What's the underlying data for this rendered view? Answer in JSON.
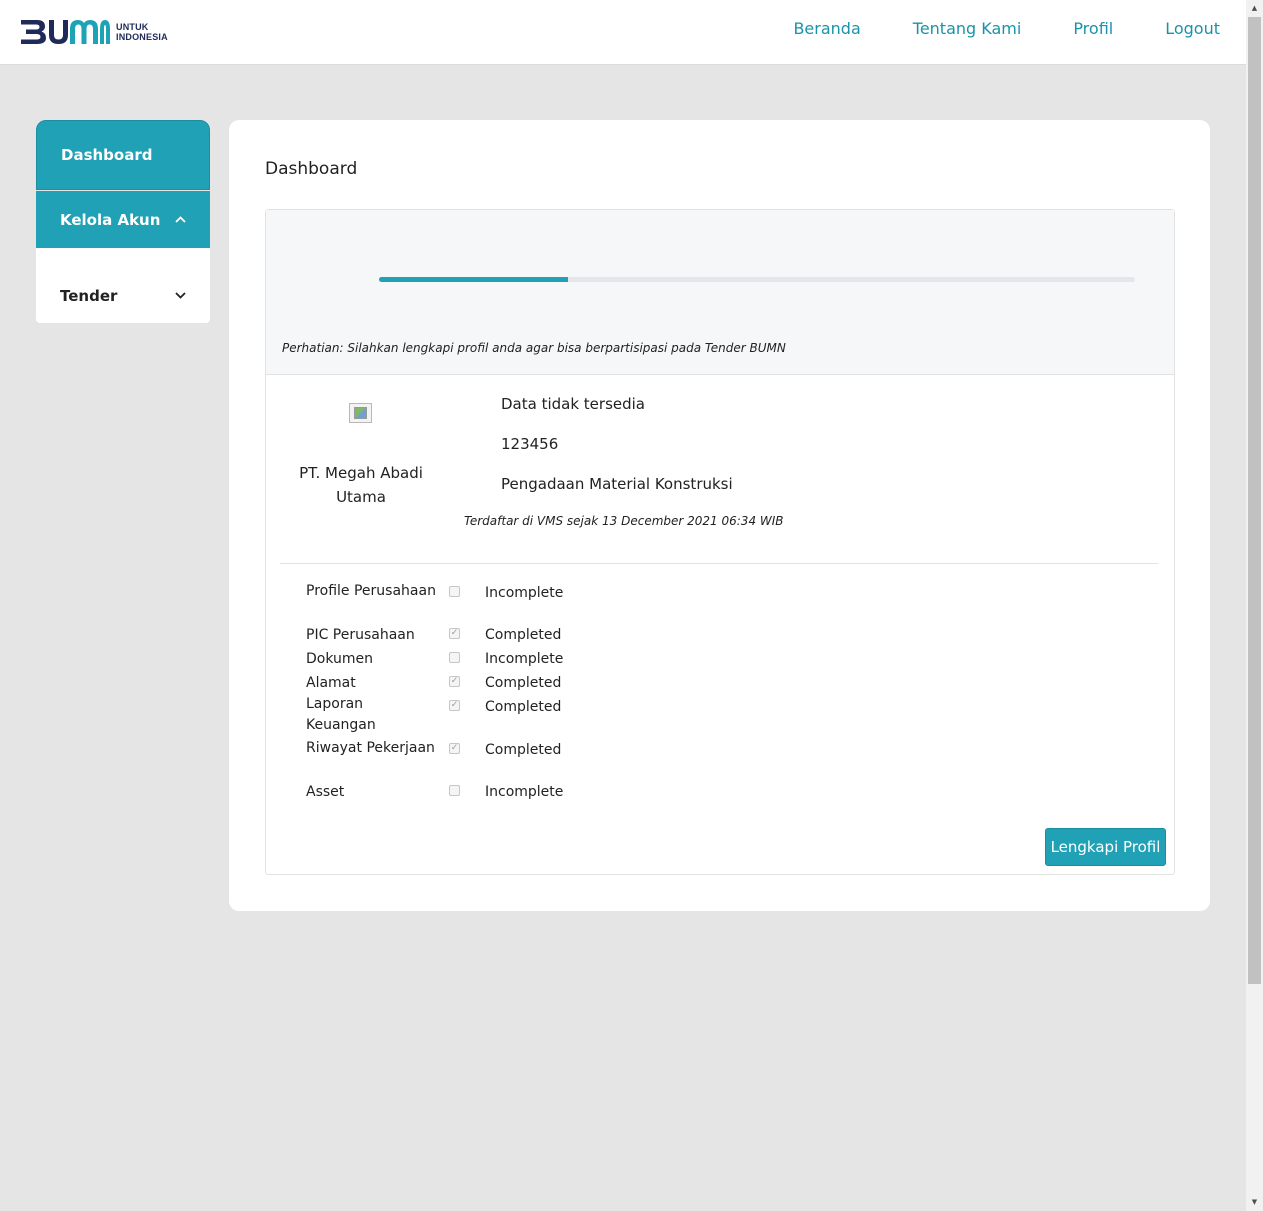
{
  "header": {
    "logo_text_line1": "UNTUK",
    "logo_text_line2": "INDONESIA",
    "nav": [
      "Beranda",
      "Tentang Kami",
      "Profil",
      "Logout"
    ]
  },
  "sidebar": {
    "items": [
      {
        "label": "Dashboard",
        "active": true
      },
      {
        "label": "Kelola Akun",
        "expanded": true,
        "icon": "chevron-up-icon"
      },
      {
        "label": "Tender",
        "expanded": false,
        "icon": "chevron-down-icon"
      }
    ]
  },
  "main": {
    "title": "Dashboard",
    "progress": 0.25,
    "notice": "Perhatian: Silahkan lengkapi profil anda agar bisa berpartisipasi pada Tender BUMN",
    "company": {
      "name": "PT. Megah Abadi Utama",
      "status": "Data tidak tersedia",
      "id": "123456",
      "category": "Pengadaan Material Konstruksi",
      "registered": "Terdaftar di VMS sejak 13 December 2021 06:34 WIB"
    },
    "checklist": [
      {
        "label": "Profile Perusahaan",
        "checked": false,
        "status": "Incomplete"
      },
      {
        "label": "PIC Perusahaan",
        "checked": true,
        "status": "Completed"
      },
      {
        "label": "Dokumen",
        "checked": false,
        "status": "Incomplete"
      },
      {
        "label": "Alamat",
        "checked": true,
        "status": "Completed"
      },
      {
        "label": "Laporan Keuangan",
        "checked": true,
        "status": "Completed"
      },
      {
        "label": "Riwayat Pekerjaan",
        "checked": true,
        "status": "Completed"
      },
      {
        "label": "Asset",
        "checked": false,
        "status": "Incomplete"
      }
    ],
    "button_label": "Lengkapi Profil"
  },
  "colors": {
    "accent": "#20a1b5",
    "nav_link": "#1a93a8",
    "logo_navy": "#1f2a5b",
    "logo_teal": "#1ea2b6"
  }
}
